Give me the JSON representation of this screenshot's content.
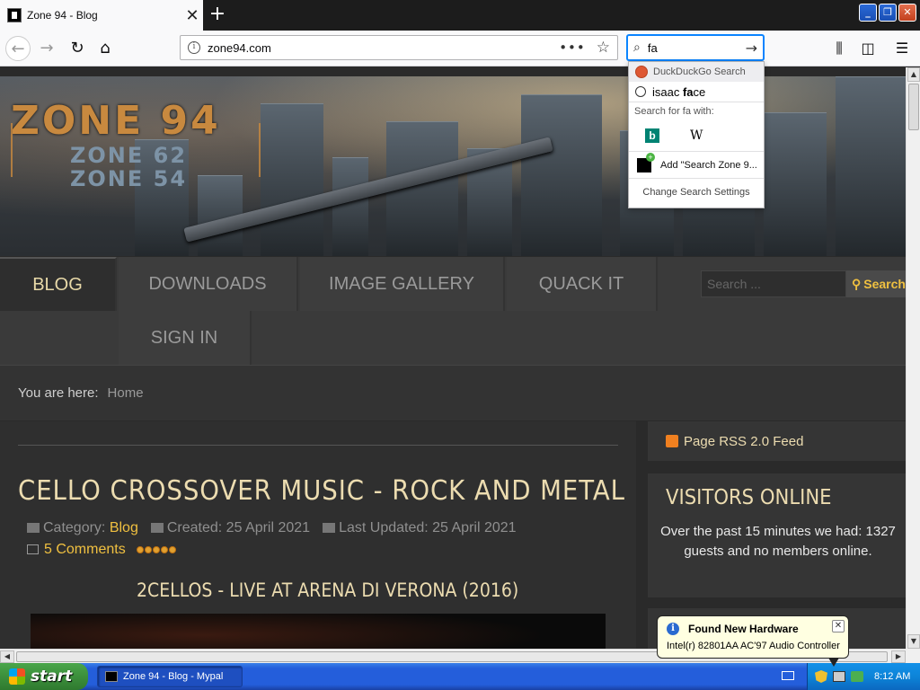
{
  "browser": {
    "tab_title": "Zone 94 - Blog",
    "tab_close": "✕",
    "new_tab": "+",
    "url": "zone94.com",
    "search_query": "fa",
    "window_buttons": {
      "minimize": "_",
      "restore": "❐",
      "close": "✕"
    }
  },
  "search_dropdown": {
    "header_engine": "DuckDuckGo Search",
    "history_prefix": "isaac ",
    "history_match": "fa",
    "history_suffix": "ce",
    "search_for_label": "Search for fa with:",
    "engines": [
      {
        "name": "Bing",
        "glyph": "b",
        "icon": "bing-icon"
      },
      {
        "name": "Wikipedia",
        "glyph": "W",
        "icon": "wikipedia-icon"
      }
    ],
    "add_engine": "Add \"Search Zone 9...",
    "settings": "Change Search Settings"
  },
  "site": {
    "logo_line1": "ZONE 94",
    "logo_line2": "ZONE 62",
    "logo_line3": "ZONE 54",
    "menu": [
      {
        "label": "BLOG",
        "active": true
      },
      {
        "label": "DOWNLOADS",
        "active": false
      },
      {
        "label": "IMAGE GALLERY",
        "active": false
      },
      {
        "label": "QUACK IT",
        "active": false
      },
      {
        "label": "SIGN IN",
        "active": false
      }
    ],
    "search_placeholder": "Search ...",
    "search_button": "Search",
    "breadcrumb_label": "You are here:",
    "breadcrumb_home": "Home"
  },
  "article": {
    "title": "CELLO CROSSOVER MUSIC - ROCK AND METAL",
    "category_label": "Category:",
    "category": "Blog",
    "created": "Created: 25 April 2021",
    "updated": "Last Updated: 25 April 2021",
    "comments": "5 Comments",
    "rating": 5,
    "subtitle": "2CELLOS - LIVE AT ARENA DI VERONA (2016)"
  },
  "sidebar": {
    "rss": "Page RSS 2.0 Feed",
    "visitors_title": "VISITORS ONLINE",
    "visitors_text": "Over the past 15 minutes we had: 1327 guests and no members online."
  },
  "balloon": {
    "title": "Found New Hardware",
    "message": "Intel(r) 82801AA AC'97 Audio Controller"
  },
  "taskbar": {
    "start": "start",
    "task": "Zone 94 - Blog - Mypal",
    "clock": "8:12 AM"
  },
  "colors": {
    "accent_gold": "#f0c040",
    "heading_cream": "#ecdcb0",
    "logo_orange": "#c8893f",
    "xp_blue": "#245edb"
  }
}
